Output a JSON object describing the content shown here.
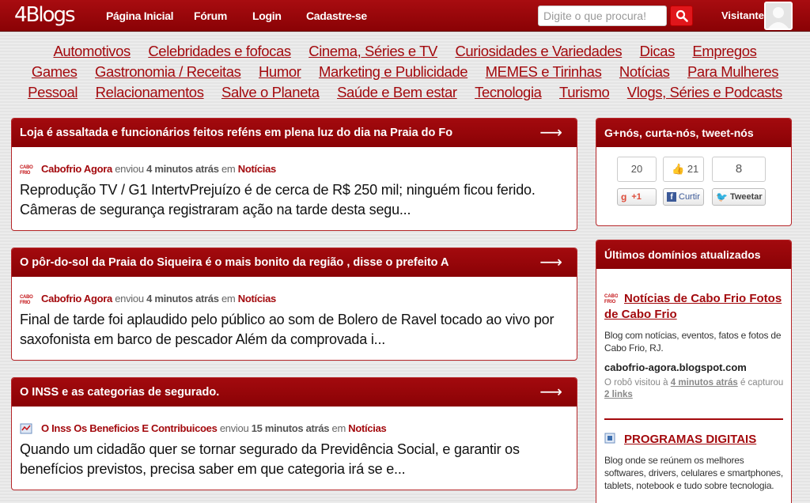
{
  "header": {
    "logo": "4Blogs",
    "nav": [
      "Página Inicial",
      "Fórum",
      "Login",
      "Cadastre-se"
    ],
    "search_placeholder": "Digite o que procura!",
    "visitor": "Visitante"
  },
  "categories": [
    "Automotivos",
    "Celebridades e fofocas",
    "Cinema, Séries e TV",
    "Curiosidades e Variedades",
    "Dicas",
    "Empregos",
    "Games",
    "Gastronomia / Receitas",
    "Humor",
    "Marketing e Publicidade",
    "MEMES e Tirinhas",
    "Notícias",
    "Para Mulheres",
    "Pessoal",
    "Relacionamentos",
    "Salve o Planeta",
    "Saúde e Bem estar",
    "Tecnologia",
    "Turismo",
    "Vlogs, Séries e Podcasts"
  ],
  "posts": [
    {
      "title": "Loja é assaltada e funcionários feitos reféns em plena luz do dia na Praia do Fo",
      "author": "Cabofrio Agora",
      "sent": "enviou",
      "time": "4 minutos atrás",
      "in": "em",
      "category": "Notícias",
      "excerpt": "Reprodução TV / G1 IntertvPrejuízo é de cerca de R$ 250 mil; ninguém ficou ferido. Câmeras de segurança registraram ação na tarde desta segu..."
    },
    {
      "title": "O pôr-do-sol da Praia do Siqueira é o mais bonito da região , disse o prefeito A",
      "author": "Cabofrio Agora",
      "sent": "enviou",
      "time": "4 minutos atrás",
      "in": "em",
      "category": "Notícias",
      "excerpt": "Final de tarde foi aplaudido pelo público ao som de Bolero de Ravel tocado ao vivo por saxofonista em barco de pescador Além da comprovada i..."
    },
    {
      "title": "O INSS e as categorias de segurado.",
      "author": "O Inss Os Beneficios E Contribuicoes",
      "sent": "enviou",
      "time": "15 minutos atrás",
      "in": "em",
      "category": "Notícias",
      "excerpt": "Quando um cidadão quer se tornar segurado da Previdência Social, e garantir os benefícios previstos, precisa saber em que categoria irá se e..."
    }
  ],
  "social": {
    "title": "G+nós, curta-nós, tweet-nós",
    "gplus_count": "20",
    "gplus_label": "+1",
    "fb_count": "21",
    "fb_label": "Curtir",
    "tw_count": "8",
    "tw_label": "Tweetar"
  },
  "domains": {
    "title": "Últimos domínios atualizados",
    "items": [
      {
        "name": "Notícias de Cabo Frio Fotos de Cabo Frio",
        "desc": "Blog com notícias, eventos, fatos e fotos de Cabo Frio, RJ.",
        "url": "cabofrio-agora.blogspot.com",
        "robot_prefix": "O robô visitou à",
        "robot_time": "4 minutos atrás",
        "robot_mid": "é capturou",
        "robot_links": "2 links"
      },
      {
        "name": "PROGRAMAS DIGITAIS",
        "desc": "Blog onde se reúnem os melhores softwares, drivers, celulares e smartphones, tablets, notebook e tudo sobre tecnologia."
      }
    ]
  },
  "colors": {
    "brand": "#9a0508",
    "link": "#a3090d",
    "search_button": "#e0161b"
  }
}
